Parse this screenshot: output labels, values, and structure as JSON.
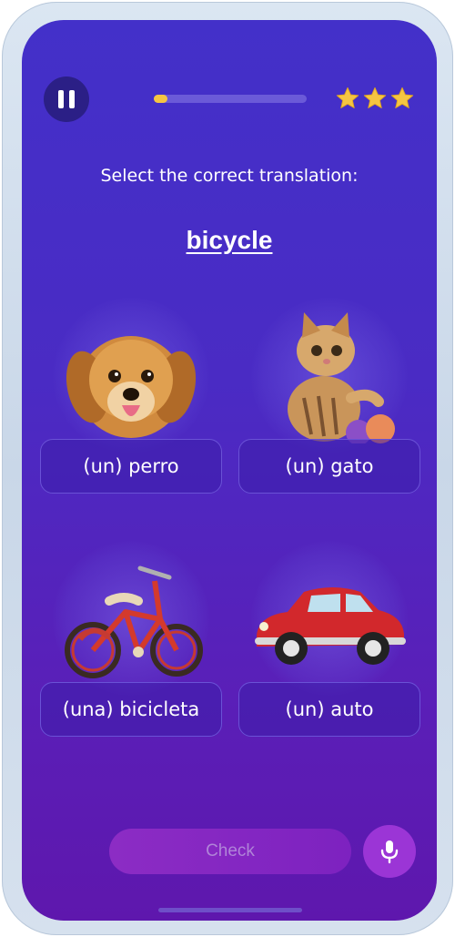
{
  "header": {
    "pause_icon": "pause-icon",
    "progress": 0.09,
    "stars": 3,
    "star_color": "#f5c542"
  },
  "lesson": {
    "prompt": "Select the correct translation:",
    "word": "bicycle"
  },
  "options": [
    {
      "label": "(un) perro",
      "image": "dog"
    },
    {
      "label": "(un) gato",
      "image": "cat"
    },
    {
      "label": "(una) bicicleta",
      "image": "bicycle"
    },
    {
      "label": "(un) auto",
      "image": "car"
    }
  ],
  "footer": {
    "check_label": "Check",
    "mic_icon": "microphone-icon"
  },
  "colors": {
    "background": "#4a2bc4",
    "accent": "#9b35d6",
    "progress_fill": "#f5c542"
  }
}
